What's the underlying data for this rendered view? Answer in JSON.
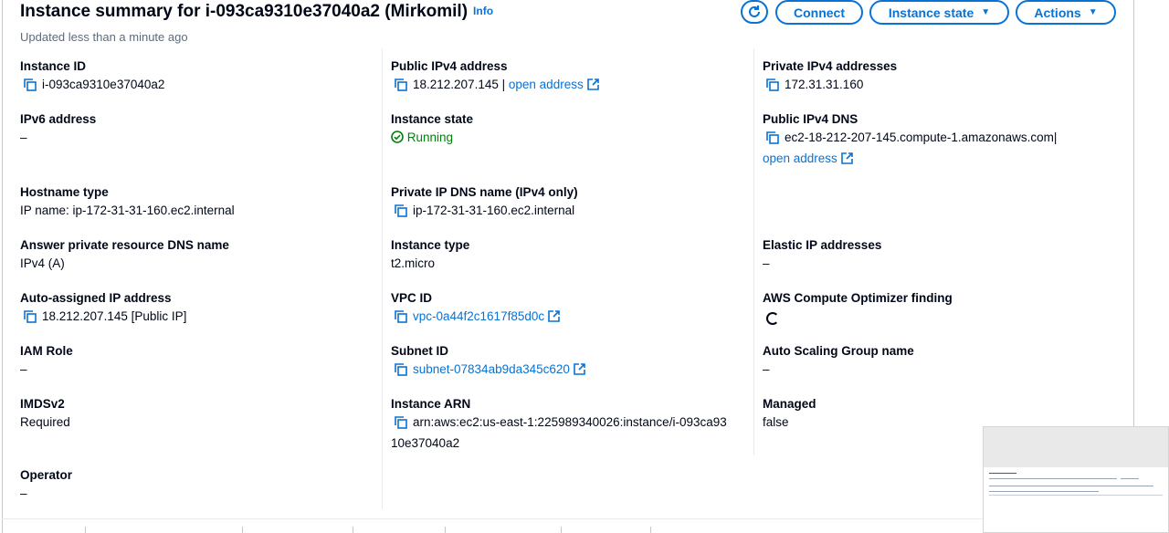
{
  "header": {
    "title": "Instance summary for i-093ca9310e37040a2 (Mirkomil)",
    "info_label": "Info",
    "updated": "Updated less than a minute ago",
    "connect_label": "Connect",
    "instance_state_label": "Instance state",
    "actions_label": "Actions"
  },
  "col1": {
    "instance_id": {
      "label": "Instance ID",
      "value": "i-093ca9310e37040a2"
    },
    "ipv6": {
      "label": "IPv6 address",
      "value": "–"
    },
    "hostname_type": {
      "label": "Hostname type",
      "value": "IP name: ip-172-31-31-160.ec2.internal"
    },
    "answer_dns": {
      "label": "Answer private resource DNS name",
      "value": "IPv4 (A)"
    },
    "auto_ip": {
      "label": "Auto-assigned IP address",
      "value": "18.212.207.145 [Public IP]"
    },
    "iam_role": {
      "label": "IAM Role",
      "value": "–"
    },
    "imdsv2": {
      "label": "IMDSv2",
      "value": "Required"
    },
    "operator": {
      "label": "Operator",
      "value": "–"
    }
  },
  "col2": {
    "public_ipv4": {
      "label": "Public IPv4 address",
      "value": "18.212.207.145",
      "separator": "|",
      "link": "open address"
    },
    "instance_state": {
      "label": "Instance state",
      "value": "Running"
    },
    "private_dns": {
      "label": "Private IP DNS name (IPv4 only)",
      "value": "ip-172-31-31-160.ec2.internal"
    },
    "instance_type": {
      "label": "Instance type",
      "value": "t2.micro"
    },
    "vpc_id": {
      "label": "VPC ID",
      "value": "vpc-0a44f2c1617f85d0c"
    },
    "subnet_id": {
      "label": "Subnet ID",
      "value": "subnet-07834ab9da345c620"
    },
    "instance_arn": {
      "label": "Instance ARN",
      "value_line1": "arn:aws:ec2:us-east-1:225989340026:instance/i-093ca93",
      "value_line2": "10e37040a2"
    }
  },
  "col3": {
    "private_ipv4": {
      "label": "Private IPv4 addresses",
      "value": "172.31.31.160"
    },
    "public_dns": {
      "label": "Public IPv4 DNS",
      "value": "ec2-18-212-207-145.compute-1.amazonaws.com",
      "separator": "|",
      "link": "open address"
    },
    "elastic_ip": {
      "label": "Elastic IP addresses",
      "value": "–"
    },
    "optimizer": {
      "label": "AWS Compute Optimizer finding"
    },
    "asg": {
      "label": "Auto Scaling Group name",
      "value": "–"
    },
    "managed": {
      "label": "Managed",
      "value": "false"
    }
  },
  "colors": {
    "link": "#0972d3",
    "running": "#037f0c",
    "text": "#000716",
    "muted": "#5f6b7a"
  }
}
